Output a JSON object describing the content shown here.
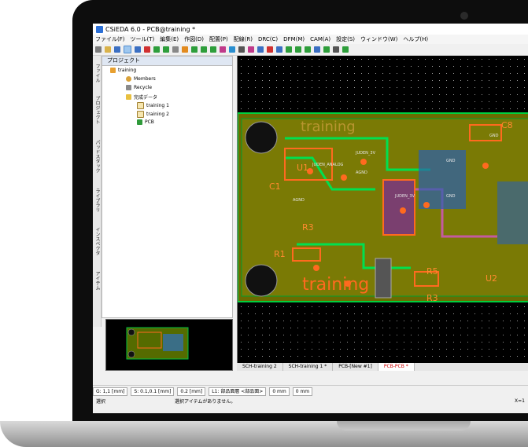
{
  "window": {
    "title": "CSiEDA 6.0 - PCB@training *"
  },
  "menu": [
    "ファイル(F)",
    "ツール(T)",
    "編集(E)",
    "作図(D)",
    "配置(P)",
    "配線(R)",
    "DRC(C)",
    "DFM(M)",
    "CAM(A)",
    "設定(S)",
    "ウィンドウ(W)",
    "ヘルプ(H)"
  ],
  "left_tabs": [
    "ファイル",
    "プロジェクト",
    "パッドスタック",
    "ライブラリ",
    "インスペクタ",
    "アイテム"
  ],
  "project_panel": {
    "header": "プロジェクト",
    "items": [
      "training",
      "Members",
      "Recycle",
      "完成データ",
      "training 1",
      "training 2",
      "PCB"
    ]
  },
  "pcb": {
    "labels": [
      "training",
      "training",
      "C1",
      "R3",
      "R1",
      "R5",
      "R3",
      "U1",
      "U2",
      "C8"
    ],
    "net_labels": [
      "JUDEN_3V",
      "JUDEN_ANALOG",
      "AGND",
      "AGND",
      "JUDEN_3V",
      "GND",
      "GND",
      "GND"
    ]
  },
  "doc_tabs": [
    "SCH-training 2",
    "SCH-training 1 *",
    "PCB-[New #1]",
    "PCB-PCB *"
  ],
  "status": {
    "grid": "G:  1,1 [mm]",
    "snap": "S:  0.1,0.1 [mm]",
    "width": "0.2 [mm]",
    "layer": "L1: 部品面層 <部品面>",
    "x_val": "0 mm",
    "y_val": "0 mm"
  },
  "message": {
    "select": "選択",
    "text": "選択アイテムがありません。",
    "right": "X=1"
  },
  "colors": {
    "board_fill": "#6b6b00",
    "copper": "#ff6a1f",
    "outline": "#00d040",
    "trace_pink": "#c45aa0"
  }
}
